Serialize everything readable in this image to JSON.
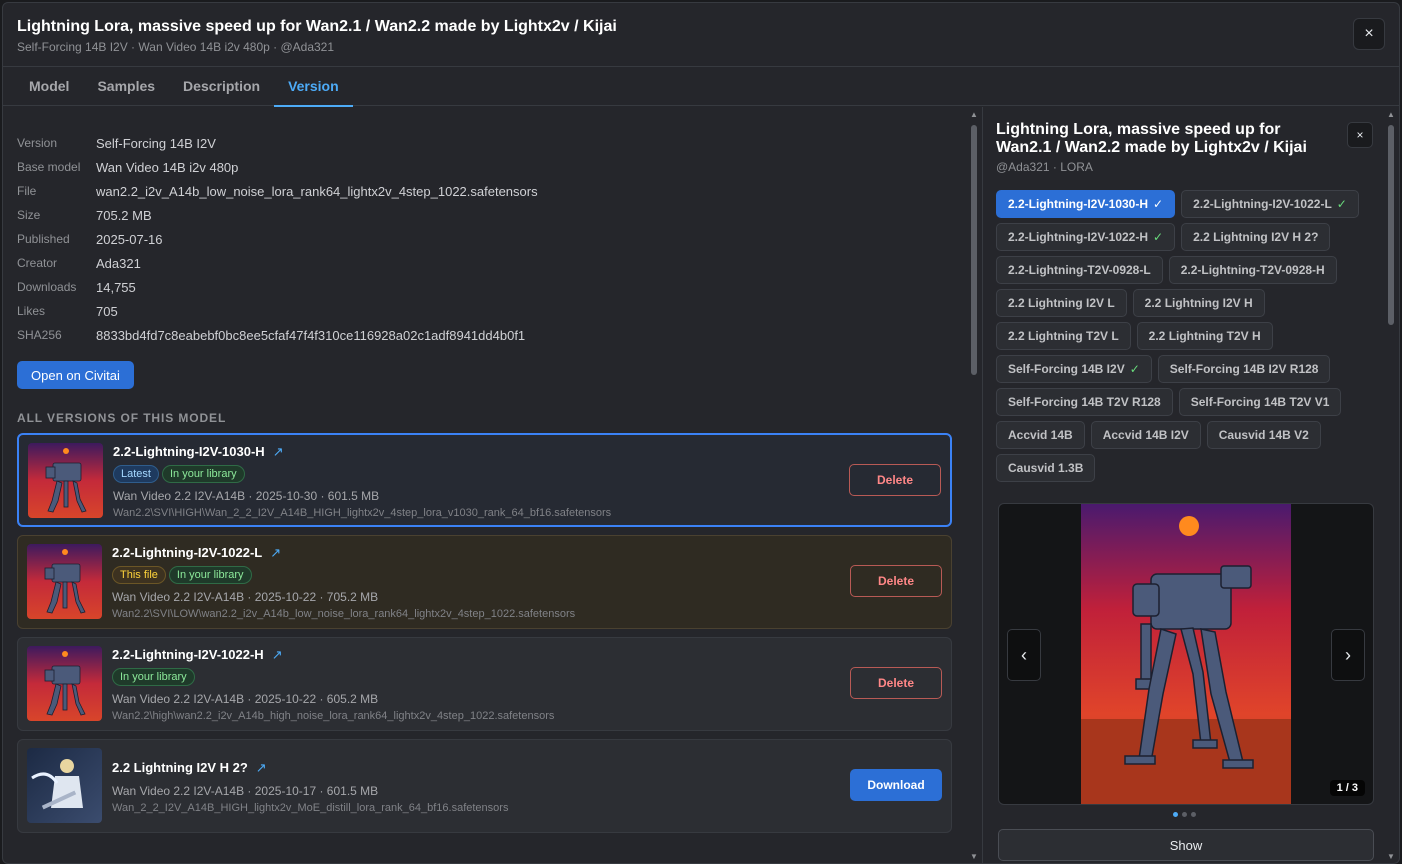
{
  "header": {
    "title": "Lightning Lora, massive speed up for Wan2.1 / Wan2.2 made by Lightx2v / Kijai",
    "subtitle": "Self-Forcing 14B I2V · Wan Video 14B i2v 480p · @Ada321",
    "close_glyph": "×"
  },
  "tabs": [
    {
      "label": "Model",
      "active": false
    },
    {
      "label": "Samples",
      "active": false
    },
    {
      "label": "Description",
      "active": false
    },
    {
      "label": "Version",
      "active": true
    }
  ],
  "details": [
    {
      "key": "Version",
      "value": "Self-Forcing 14B I2V"
    },
    {
      "key": "Base model",
      "value": "Wan Video 14B i2v 480p"
    },
    {
      "key": "File",
      "value": "wan2.2_i2v_A14b_low_noise_lora_rank64_lightx2v_4step_1022.safetensors"
    },
    {
      "key": "Size",
      "value": "705.2 MB"
    },
    {
      "key": "Published",
      "value": "2025-07-16"
    },
    {
      "key": "Creator",
      "value": "Ada321"
    },
    {
      "key": "Downloads",
      "value": "14,755"
    },
    {
      "key": "Likes",
      "value": "705"
    },
    {
      "key": "SHA256",
      "value": "8833bd4fd7c8eabebf0bc8ee5cfaf47f4f310ce116928a02c1adf8941dd4b0f1"
    }
  ],
  "open_button": "Open on Civitai",
  "versions_heading": "ALL VERSIONS OF THIS MODEL",
  "versions": [
    {
      "name": "2.2-Lightning-I2V-1030-H",
      "external_glyph": "↗",
      "badges": [
        {
          "text": "Latest",
          "kind": "latest"
        },
        {
          "text": "In your library",
          "kind": "lib"
        }
      ],
      "info": "Wan Video 2.2 I2V-A14B · 2025-10-30 · 601.5 MB",
      "path": "Wan2.2\\SVI\\HIGH\\Wan_2_2_I2V_A14B_HIGH_lightx2v_4step_lora_v1030_rank_64_bf16.safetensors",
      "action": "Delete",
      "thumb": "robot"
    },
    {
      "name": "2.2-Lightning-I2V-1022-L",
      "external_glyph": "↗",
      "badges": [
        {
          "text": "This file",
          "kind": "this"
        },
        {
          "text": "In your library",
          "kind": "lib"
        }
      ],
      "info": "Wan Video 2.2 I2V-A14B · 2025-10-22 · 705.2 MB",
      "path": "Wan2.2\\SVI\\LOW\\wan2.2_i2v_A14b_low_noise_lora_rank64_lightx2v_4step_1022.safetensors",
      "action": "Delete",
      "thumb": "robot"
    },
    {
      "name": "2.2-Lightning-I2V-1022-H",
      "external_glyph": "↗",
      "badges": [
        {
          "text": "In your library",
          "kind": "lib"
        }
      ],
      "info": "Wan Video 2.2 I2V-A14B · 2025-10-22 · 605.2 MB",
      "path": "Wan2.2\\high\\wan2.2_i2v_A14b_high_noise_lora_rank64_lightx2v_4step_1022.safetensors",
      "action": "Delete",
      "thumb": "robot"
    },
    {
      "name": "2.2 Lightning I2V H 2?",
      "external_glyph": "↗",
      "badges": [],
      "info": "Wan Video 2.2 I2V-A14B · 2025-10-17 · 601.5 MB",
      "path": "Wan_2_2_I2V_A14B_HIGH_lightx2v_MoE_distill_lora_rank_64_bf16.safetensors",
      "action": "Download",
      "thumb": "knight"
    }
  ],
  "panel": {
    "title": "Lightning Lora, massive speed up for Wan2.1 / Wan2.2 made by Lightx2v / Kijai",
    "subtitle": "@Ada321 · LORA",
    "close_glyph": "×",
    "check_glyph": "✓",
    "chips": [
      {
        "label": "2.2-Lightning-I2V-1030-H",
        "active": true,
        "checked": true
      },
      {
        "label": "2.2-Lightning-I2V-1022-L",
        "active": false,
        "checked": true
      },
      {
        "label": "2.2-Lightning-I2V-1022-H",
        "active": false,
        "checked": true
      },
      {
        "label": "2.2 Lightning I2V H 2?",
        "active": false,
        "checked": false
      },
      {
        "label": "2.2-Lightning-T2V-0928-L",
        "active": false,
        "checked": false
      },
      {
        "label": "2.2-Lightning-T2V-0928-H",
        "active": false,
        "checked": false
      },
      {
        "label": "2.2 Lightning I2V L",
        "active": false,
        "checked": false
      },
      {
        "label": "2.2 Lightning I2V H",
        "active": false,
        "checked": false
      },
      {
        "label": "2.2 Lightning T2V L",
        "active": false,
        "checked": false
      },
      {
        "label": "2.2 Lightning T2V H",
        "active": false,
        "checked": false
      },
      {
        "label": "Self-Forcing 14B I2V",
        "active": false,
        "checked": true
      },
      {
        "label": "Self-Forcing 14B I2V R128",
        "active": false,
        "checked": false
      },
      {
        "label": "Self-Forcing 14B T2V R128",
        "active": false,
        "checked": false
      },
      {
        "label": "Self-Forcing 14B T2V V1",
        "active": false,
        "checked": false
      },
      {
        "label": "Accvid 14B",
        "active": false,
        "checked": false
      },
      {
        "label": "Accvid 14B I2V",
        "active": false,
        "checked": false
      },
      {
        "label": "Causvid 14B V2",
        "active": false,
        "checked": false
      },
      {
        "label": "Causvid 1.3B",
        "active": false,
        "checked": false
      }
    ],
    "viewer": {
      "counter": "1 / 3",
      "prev_glyph": "‹",
      "next_glyph": "›",
      "current": 1,
      "total": 3
    },
    "show_button": "Show"
  },
  "colors": {
    "accent": "#2c6fd6",
    "link": "#4dabf7",
    "danger": "#ff8787",
    "success": "#69db7c"
  }
}
